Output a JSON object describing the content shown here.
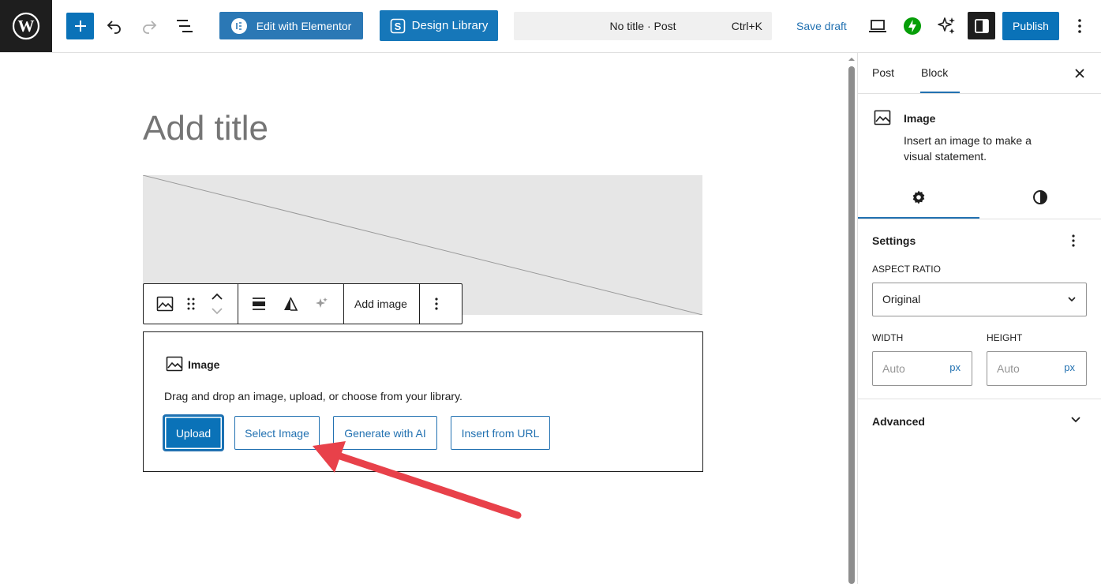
{
  "topbar": {
    "logo_icon": "wordpress-logo-icon",
    "elementor_label": "Edit with Elementor",
    "design_library_label": "Design Library",
    "command_title": "No title · Post",
    "command_shortcut": "Ctrl+K",
    "save_draft_label": "Save draft",
    "publish_label": "Publish"
  },
  "editor": {
    "title_placeholder": "Add title",
    "block_toolbar": {
      "add_image_label": "Add image"
    },
    "image_block": {
      "title": "Image",
      "description": "Drag and drop an image, upload, or choose from your library.",
      "buttons": [
        {
          "label": "Upload"
        },
        {
          "label": "Select Image"
        },
        {
          "label": "Generate with AI"
        },
        {
          "label": "Insert from URL"
        }
      ]
    }
  },
  "sidebar": {
    "tabs": [
      {
        "label": "Post"
      },
      {
        "label": "Block"
      }
    ],
    "block_card": {
      "title": "Image",
      "description": "Insert an image to make a visual statement."
    },
    "settings": {
      "title": "Settings",
      "aspect_ratio_label": "ASPECT RATIO",
      "aspect_ratio_value": "Original",
      "width_label": "WIDTH",
      "height_label": "HEIGHT",
      "width_placeholder": "Auto",
      "height_placeholder": "Auto",
      "unit": "px"
    },
    "advanced_label": "Advanced"
  },
  "colors": {
    "accent": "#2271b1",
    "primary_button": "#0a72b8",
    "annotation_arrow": "#e8414a"
  }
}
